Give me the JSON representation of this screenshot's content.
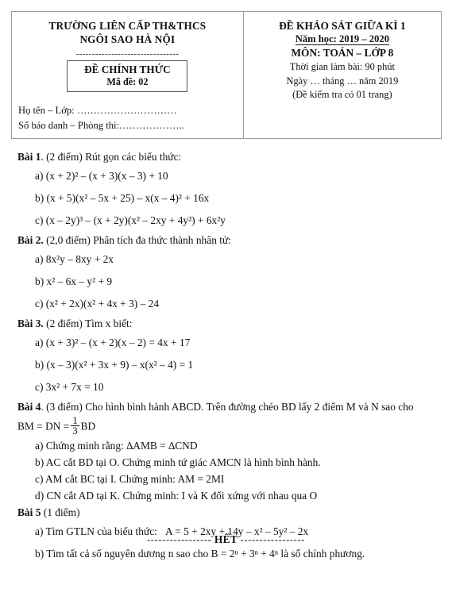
{
  "header": {
    "school_line1": "TRƯỜNG LIÊN CẤP TH&THCS",
    "school_line2": "NGÔI SAO HÀ NỘI",
    "dashed_rule": "--------------------------------",
    "official_title": "ĐỀ CHÍNH THỨC",
    "official_code": "Mã đề: 02",
    "student_name_line": "Họ tên – Lớp: …………………………",
    "student_id_line": "Số báo danh – Phòng thi:………………..",
    "exam_title": "ĐỀ KHẢO SÁT GIỮA KÌ 1",
    "school_year": "Năm học: 2019 – 2020",
    "subject": "MÔN: TOÁN – LỚP 8",
    "duration": "Thời gian làm bài: 90 phút",
    "date_line": "Ngày … tháng … năm 2019",
    "pages_note": "(Đề kiểm tra có 01 trang)"
  },
  "problems": {
    "p1": {
      "label": "Bài 1",
      "points": ". (2 điểm)",
      "prompt": "Rút gọn các biểu thức:",
      "a_marker": "a)",
      "b_marker": "b)",
      "c_marker": "c)"
    },
    "p2": {
      "label": "Bài 2.",
      "points": "(2,0 điểm)",
      "prompt": "Phân tích đa thức thành nhân tử:",
      "a_marker": "a)",
      "b_marker": "b)",
      "c_marker": "c)"
    },
    "p3": {
      "label": "Bài 3.",
      "points": "(2 điểm)",
      "prompt": "Tìm x biết:",
      "a_marker": "a)",
      "b_marker": "b)",
      "c_marker": "c)"
    },
    "p4": {
      "label": "Bài 4",
      "points": ". (3 điểm)",
      "prompt": "Cho hình bình hành ABCD. Trên đường chéo BD lấy 2 điểm M và N sao cho",
      "condition_prefix": "BM = DN =",
      "condition_num": "1",
      "condition_den": "3",
      "condition_suffix": "BD",
      "a": "a) Chứng minh rằng:  ∆AMB = ∆CND",
      "b": "b) AC cắt BD tại O. Chứng minh tứ giác AMCN là hình bình hành.",
      "c": "c) AM cắt BC tại I. Chứng minh: AM = 2MI",
      "d": "d) CN cắt AD tại K. Chứng minh: I và K đối xứng với nhau qua O"
    },
    "p5": {
      "label": "Bài 5",
      "points": "(1 điểm)",
      "a_marker": "a)",
      "a_text": "Tìm GTLN của biểu thức:",
      "b_marker": "b)",
      "b_text_pre": "Tìm tất cả số nguyên dương n sao cho",
      "b_text_post": "là số chính phương."
    }
  },
  "math": {
    "p1a": "(x + 2)² – (x + 3)(x – 3) + 10",
    "p1b": "(x + 5)(x² – 5x + 25) – x(x – 4)² + 16x",
    "p1c": "(x – 2y)³ – (x + 2y)(x² – 2xy + 4y²) + 6x²y",
    "p2a": "8x²y – 8xy + 2x",
    "p2b": "x² – 6x – y² + 9",
    "p2c": "(x² + 2x)(x² + 4x + 3) – 24",
    "p3a": "(x + 3)² – (x + 2)(x – 2) = 4x + 17",
    "p3b": "(x – 3)(x² + 3x + 9) – x(x² – 4) = 1",
    "p3c": "3x² + 7x = 10",
    "p5a": "A = 5 + 2xy + 14y – x² – 5y² – 2x",
    "p5b": "B = 2ⁿ + 3ⁿ + 4ⁿ"
  },
  "footer": {
    "left_dashes": "-----------------",
    "het": "HẾT",
    "right_dashes": "-----------------"
  }
}
